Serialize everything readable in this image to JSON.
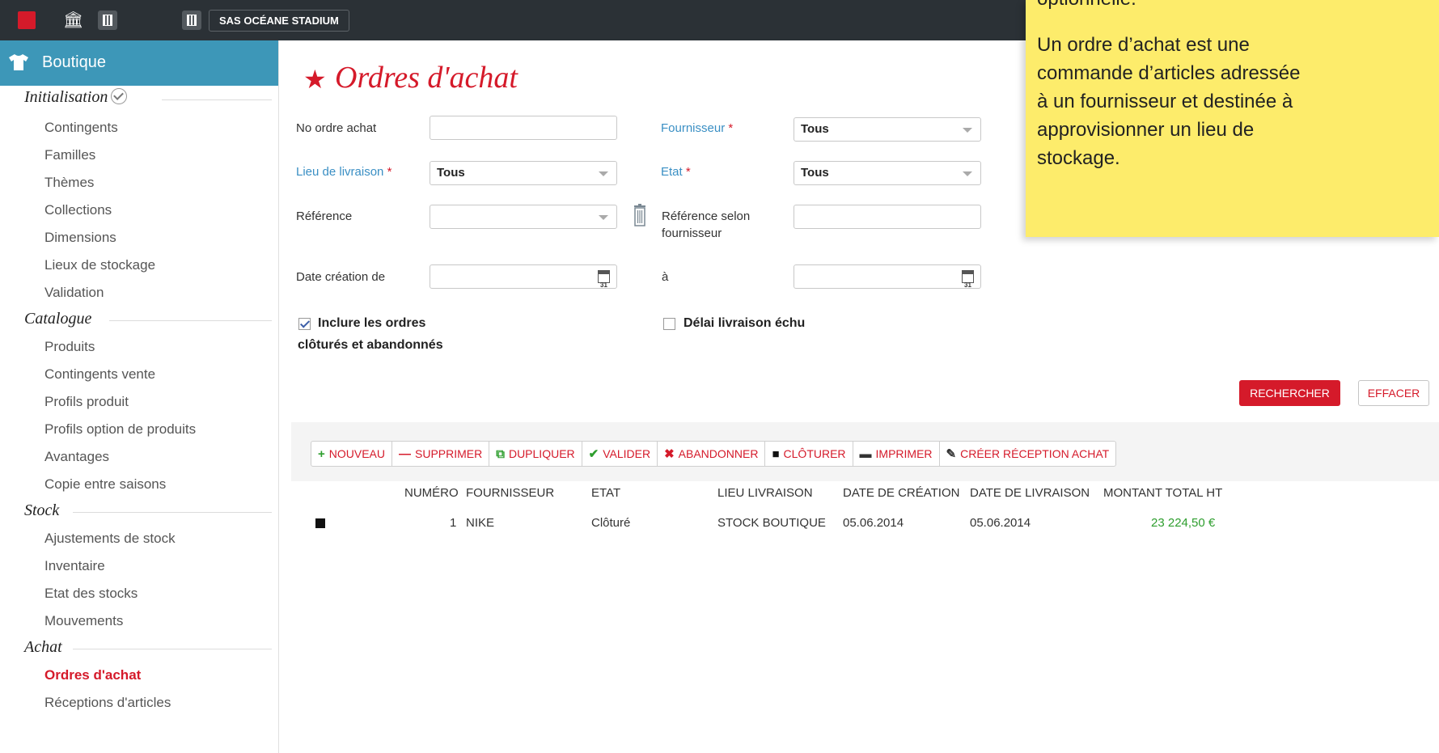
{
  "topbar": {
    "venue": "SAS OCÉANE STADIUM"
  },
  "sidebar": {
    "module": "Boutique",
    "sections": [
      {
        "title": "Initialisation",
        "items": [
          "Contingents",
          "Familles",
          "Thèmes",
          "Collections",
          "Dimensions",
          "Lieux de stockage",
          "Validation"
        ]
      },
      {
        "title": "Catalogue",
        "items": [
          "Produits",
          "Contingents vente",
          "Profils produit",
          "Profils option de produits",
          "Avantages",
          "Copie entre saisons"
        ]
      },
      {
        "title": "Stock",
        "items": [
          "Ajustements de stock",
          "Inventaire",
          "Etat des stocks",
          "Mouvements"
        ]
      },
      {
        "title": "Achat",
        "items": [
          "Ordres d'achat",
          "Réceptions d'articles"
        ]
      }
    ],
    "active_item": "Ordres d'achat"
  },
  "page": {
    "title": "Ordres d'achat"
  },
  "form": {
    "no_ordre_label": "No ordre achat",
    "no_ordre_value": "",
    "fournisseur_label": "Fournisseur",
    "fournisseur_value": "Tous",
    "lieu_label": "Lieu de livraison",
    "lieu_value": "Tous",
    "etat_label": "Etat",
    "etat_value": "Tous",
    "required_mark": "*",
    "reference_label": "Référence",
    "reference_value": "",
    "ref_fournisseur_label_1": "Référence selon",
    "ref_fournisseur_label_2": "fournisseur",
    "ref_fournisseur_value": "",
    "date_de_label": "Date création de",
    "date_a_label": "à",
    "inclure_label_1": "Inclure les ordres",
    "inclure_label_2": "clôturés et abandonnés",
    "inclure_checked": true,
    "delai_label": "Délai livraison échu",
    "delai_checked": false,
    "search_button": "RECHERCHER",
    "clear_button": "EFFACER"
  },
  "toolbar": [
    {
      "icon": "+",
      "label": "NOUVEAU",
      "color": "#2e9e2e"
    },
    {
      "icon": "—",
      "label": "SUPPRIMER",
      "color": "#d51a2a"
    },
    {
      "icon": "⧉",
      "label": "DUPLIQUER",
      "color": "#2e9e2e"
    },
    {
      "icon": "✔",
      "label": "VALIDER",
      "color": "#2e9e2e"
    },
    {
      "icon": "✖",
      "label": "ABANDONNER",
      "color": "#d51a2a"
    },
    {
      "icon": "■",
      "label": "CLÔTURER",
      "color": "#111111"
    },
    {
      "icon": "🖶",
      "label": "IMPRIMER",
      "color": "#333333"
    },
    {
      "icon": "✎",
      "label": "CRÉER RÉCEPTION ACHAT",
      "color": "#333333"
    }
  ],
  "table": {
    "headers": [
      "NUMÉRO",
      "FOURNISSEUR",
      "ETAT",
      "LIEU LIVRAISON",
      "DATE DE CRÉATION",
      "DATE DE LIVRAISON",
      "MONTANT TOTAL HT"
    ],
    "rows": [
      [
        "1",
        "NIKE",
        "Clôturé",
        "STOCK BOUTIQUE",
        "05.06.2014",
        "05.06.2014",
        "23 224,50 €"
      ]
    ]
  },
  "note": {
    "line0": "optionnelle.",
    "lines": [
      "Un ordre d’achat est une",
      "commande d’articles adressée",
      "à un fournisseur et destinée à",
      "approvisionner un lieu de",
      "stockage."
    ]
  }
}
